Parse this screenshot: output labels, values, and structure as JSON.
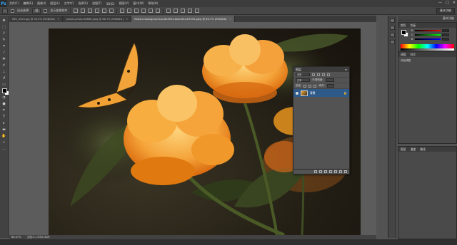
{
  "app": {
    "logo": "Ps"
  },
  "menu": [
    "文件(F)",
    "编辑(E)",
    "图像(I)",
    "图层(L)",
    "文字(Y)",
    "选择(S)",
    "滤镜(T)",
    "3D(D)",
    "视图(V)",
    "窗口(W)",
    "帮助(H)"
  ],
  "window_controls": [
    "—",
    "□",
    "✕"
  ],
  "options": {
    "auto_select_label": "自动选择:",
    "auto_select_value": "组",
    "show_transform_label": "显示变换控件",
    "workspace": "基本功能"
  },
  "tabs": [
    {
      "label": "IMG_0025.jpg @ 33.3% (RGB/8#)",
      "active": false
    },
    {
      "label": "pexels-photo-56866.jpeg @ 66.7% (RGB/8#)",
      "active": false
    },
    {
      "label": "flowers-background-butterflies-beautiful-87452.jpeg @ 66.7% (RGB/8#)",
      "active": true
    }
  ],
  "status": {
    "zoom": "66.67%",
    "doc": "文档:3.17M/6.34M"
  },
  "layers_panel": {
    "title": "图层",
    "kind_label": "类型",
    "blend_mode": "正常",
    "opacity_label": "不透明度:",
    "lock_label": "锁定:",
    "fill_label": "填充:",
    "layer_name": "背景"
  },
  "right_panels": {
    "top_button": "基本功能",
    "color_tabs": [
      "颜色",
      "色板"
    ],
    "adj_tabs": [
      "调整",
      "样式"
    ],
    "adj_label": "添加调整",
    "layers_tabs": [
      "图层",
      "通道",
      "路径"
    ]
  },
  "colors": {
    "accent": "#31a8ff",
    "selected_layer": "#2e5a8a",
    "petal_light": "#f8b84a",
    "petal_dark": "#e07a10",
    "butterfly": "#f2a43a"
  }
}
